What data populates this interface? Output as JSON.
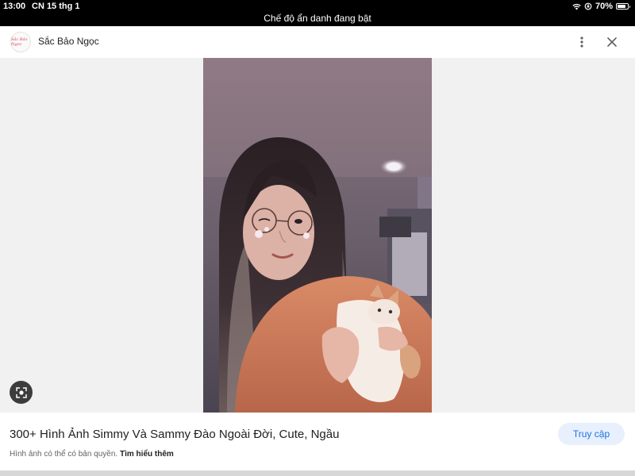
{
  "status_bar": {
    "time": "13:00",
    "date": "CN 15 thg 1",
    "battery": "70%",
    "battery_level": 0.7,
    "incognito_banner": "Chế độ ẩn danh đang bật"
  },
  "header": {
    "site_name": "Sắc Bảo Ngọc",
    "logo_text": "Sắc Bảo Ngọc",
    "more_icon": "more-vert-icon",
    "close_icon": "close-icon"
  },
  "image": {
    "lens_icon": "lens-search-icon"
  },
  "footer": {
    "title": "300+ Hình Ảnh Simmy Và Sammy Đào Ngoài Đời, Cute, Ngầu",
    "visit_label": "Truy cập",
    "copyright_text": "Hình ảnh có thể có bản quyền.",
    "learn_more": "Tìm hiểu thêm"
  },
  "colors": {
    "status_bar_bg": "#000000",
    "image_bg": "#f1f1f1",
    "visit_button_bg": "#e8f0fe",
    "visit_button_text": "#1a73e8",
    "title_text": "#202124"
  }
}
